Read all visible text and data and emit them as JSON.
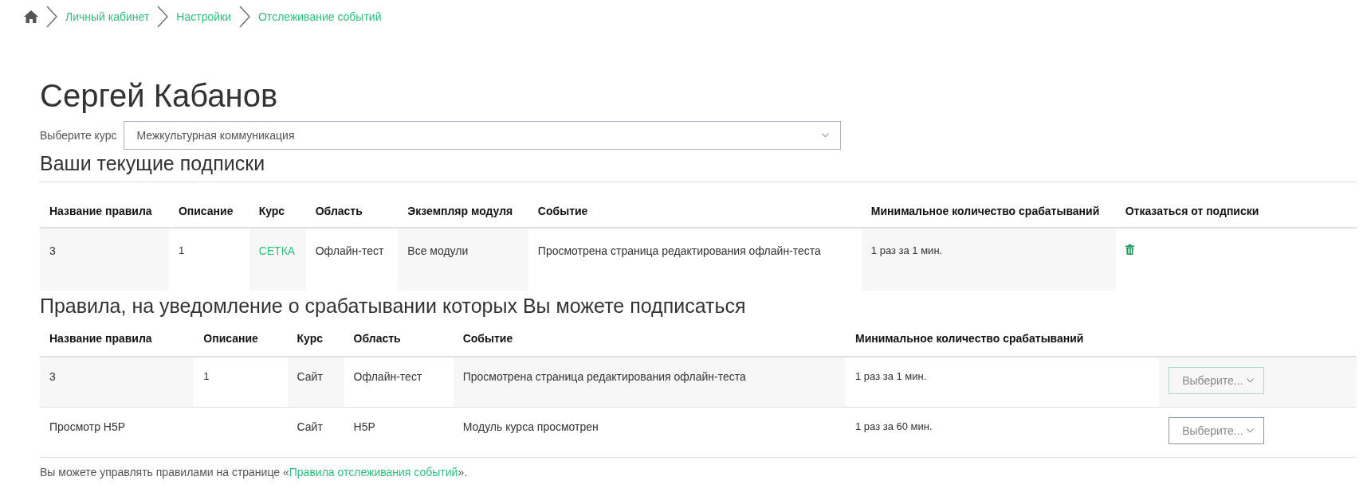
{
  "breadcrumb": [
    {
      "label": "Личный кабинет"
    },
    {
      "label": "Настройки"
    },
    {
      "label": "Отслеживание событий"
    }
  ],
  "title": "Сергей Кабанов",
  "course_select": {
    "label": "Выберите курс",
    "value": "Межкультурная коммуникация"
  },
  "subscriptions": {
    "heading": "Ваши текущие подписки",
    "columns": [
      "Название правила",
      "Описание",
      "Курс",
      "Область",
      "Экземпляр модуля",
      "Событие",
      "Минимальное количество срабатываний",
      "Отказаться от подписки"
    ],
    "rows": [
      {
        "name": "3",
        "description": "1",
        "course": "СЕТКА",
        "area": "Офлайн-тест",
        "module": "Все модули",
        "event": "Просмотрена страница редактирования офлайн-теста",
        "frequency": "1 раз за 1 мин."
      }
    ]
  },
  "rules": {
    "heading": "Правила, на уведомление о срабатывании которых Вы можете подписаться",
    "columns": [
      "Название правила",
      "Описание",
      "Курс",
      "Область",
      "Событие",
      "Минимальное количество срабатываний"
    ],
    "rows": [
      {
        "name": "3",
        "description": "1",
        "course": "Сайт",
        "area": "Офлайн-тест",
        "event": "Просмотрена страница редактирования офлайн-теста",
        "frequency": "1 раз за 1 мин.",
        "action": "Выберите...",
        "focused": true
      },
      {
        "name": "Просмотр H5P",
        "description": "",
        "course": "Сайт",
        "area": "H5P",
        "event": "Модуль курса просмотрен",
        "frequency": "1 раз за 60 мин.",
        "action": "Выберите...",
        "focused": false
      }
    ]
  },
  "footer": {
    "before": "Вы можете управлять правилами на странице «",
    "link": "Правила отслеживания событий",
    "after": "»."
  }
}
